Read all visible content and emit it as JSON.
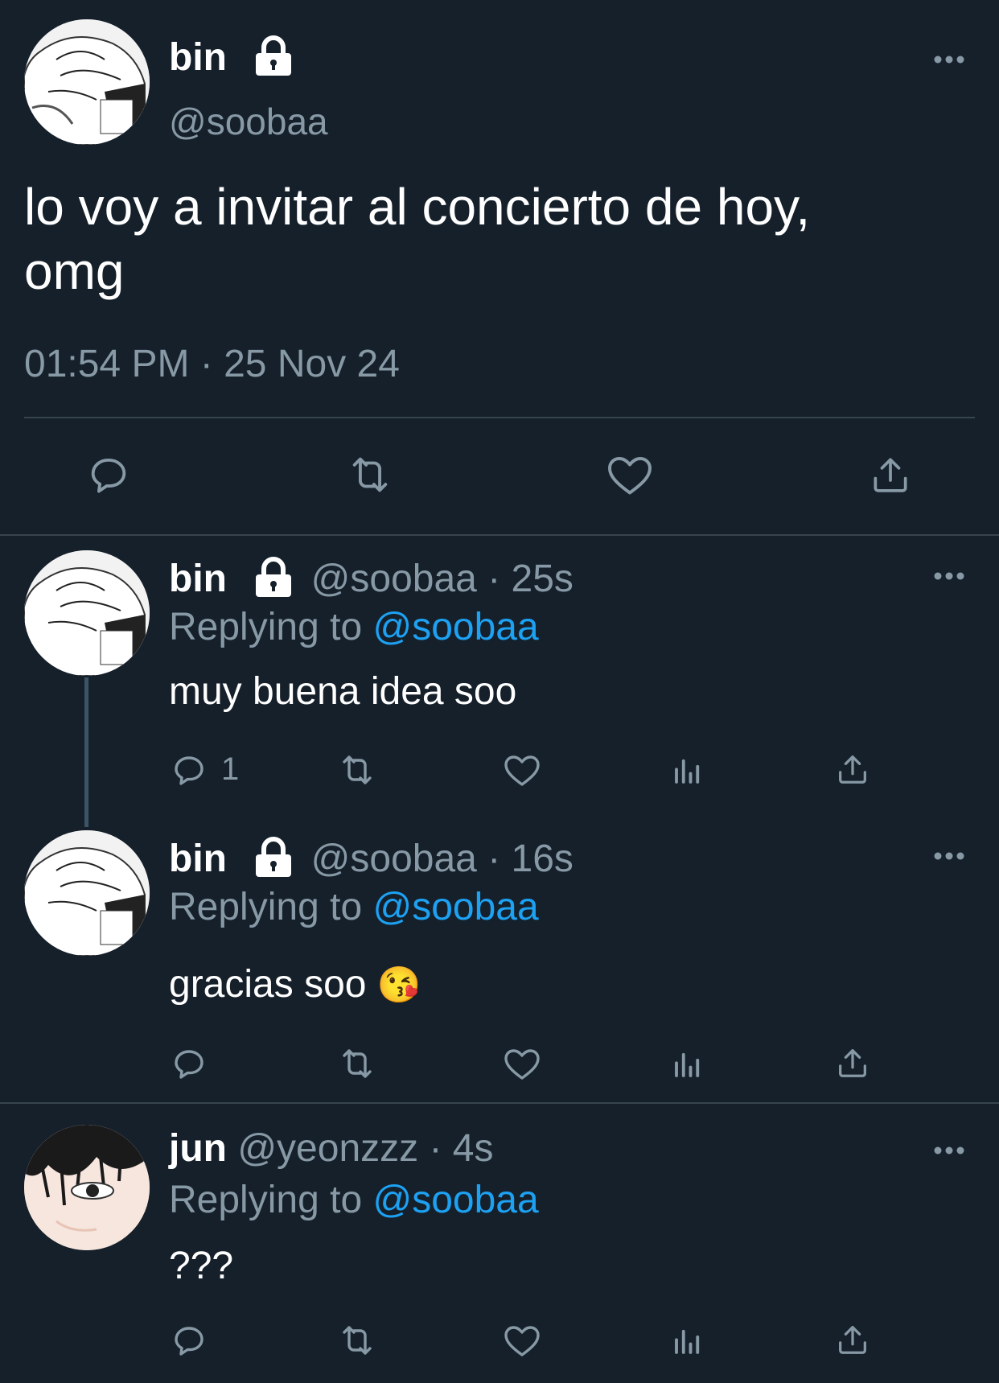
{
  "main_tweet": {
    "display_name": "bin",
    "handle": "@soobaa",
    "text_line1": "lo voy a invitar al concierto de hoy,",
    "text_line2": "omg",
    "timestamp": "01:54 PM · 25 Nov 24",
    "actions": [
      "reply-icon",
      "retweet-icon",
      "like-icon",
      "share-icon"
    ]
  },
  "replies": [
    {
      "display_name": "bin",
      "handle": "@soobaa",
      "time": "· 25s",
      "replying_prefix": "Replying to",
      "replying_to": "@soobaa",
      "text": "muy buena idea soo",
      "reply_count": "1",
      "emoji": ""
    },
    {
      "display_name": "bin",
      "handle": "@soobaa",
      "time": "· 16s",
      "replying_prefix": "Replying to",
      "replying_to": "@soobaa",
      "text": "gracias soo",
      "emoji": "😘"
    },
    {
      "display_name": "jun",
      "handle": "@yeonzzz",
      "time": "· 4s",
      "replying_prefix": "Replying to",
      "replying_to": "@soobaa",
      "text": "???"
    }
  ],
  "colors": {
    "background": "#15202b",
    "muted": "#8899a6",
    "accent": "#1da1f2",
    "divider": "#38444d"
  }
}
